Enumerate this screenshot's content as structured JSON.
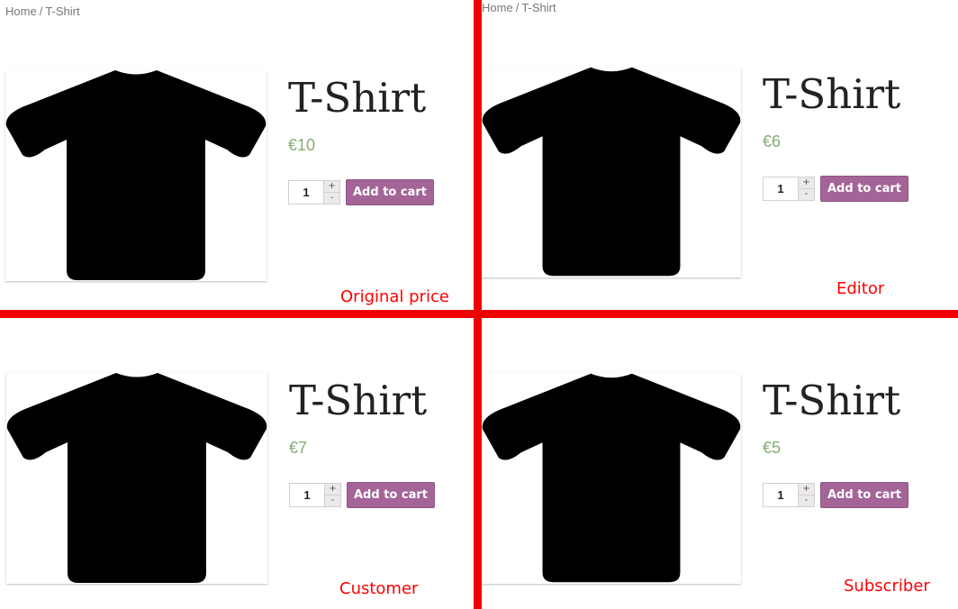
{
  "breadcrumb": {
    "home": "Home",
    "separator": "/",
    "current": "T-Shirt"
  },
  "product_title": "T-Shirt",
  "quantity": "1",
  "stepper": {
    "plus": "+",
    "minus": "-"
  },
  "add_to_cart_label": "Add to cart",
  "panels": {
    "original": {
      "price": "€10",
      "caption": "Original price"
    },
    "editor": {
      "price": "€6",
      "caption": "Editor"
    },
    "customer": {
      "price": "€7",
      "caption": "Customer"
    },
    "subscriber": {
      "price": "€5",
      "caption": "Subscriber"
    }
  },
  "colors": {
    "divider": "#ee0000",
    "caption": "#ff0000",
    "price": "#85ad74",
    "button": "#a46497"
  },
  "icons": [
    "tshirt-icon"
  ]
}
